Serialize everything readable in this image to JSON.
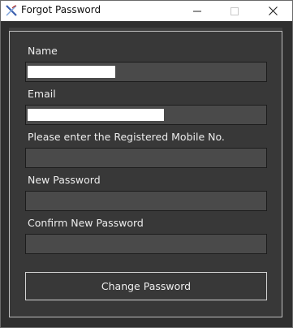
{
  "window": {
    "title": "Forgot Password",
    "icon": "feather-x-app-icon",
    "minimize_icon": "minimize-icon",
    "maximize_icon": "maximize-icon",
    "close_icon": "close-icon"
  },
  "form": {
    "name": {
      "label": "Name",
      "value": "",
      "placeholder": ""
    },
    "email": {
      "label": "Email",
      "value": "",
      "placeholder": ""
    },
    "mobile": {
      "label": "Please enter the Registered Mobile No.",
      "value": "",
      "placeholder": ""
    },
    "new_password": {
      "label": "New Password",
      "value": "",
      "placeholder": ""
    },
    "confirm_password": {
      "label": "Confirm New Password",
      "value": "",
      "placeholder": ""
    },
    "submit_label": "Change Password"
  },
  "colors": {
    "window_bg": "#2f2f2f",
    "panel_bg": "#383838",
    "field_bg": "#4a4a4a",
    "text": "#ececec"
  }
}
